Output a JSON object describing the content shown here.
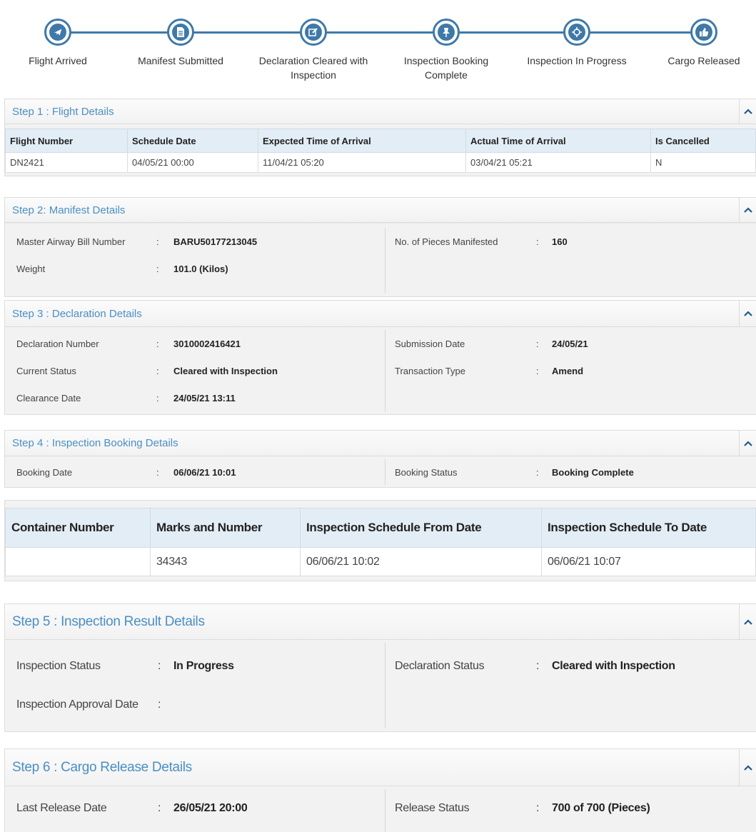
{
  "tracker": {
    "accent": "#3f79a8",
    "steps": [
      {
        "label_line1": "Flight Arrived",
        "label_line2": "",
        "icon": "plane-icon"
      },
      {
        "label_line1": "Manifest Submitted",
        "label_line2": "",
        "icon": "document-icon"
      },
      {
        "label_line1": "Declaration Cleared with",
        "label_line2": "Inspection",
        "icon": "edit-icon"
      },
      {
        "label_line1": "Inspection Booking",
        "label_line2": "Complete",
        "icon": "pin-icon"
      },
      {
        "label_line1": "Inspection In Progress",
        "label_line2": "",
        "icon": "crosshair-icon"
      },
      {
        "label_line1": "Cargo Released",
        "label_line2": "",
        "icon": "thumbs-up-icon"
      }
    ]
  },
  "step1": {
    "title": "Step 1 : Flight Details",
    "headers": [
      "Flight Number",
      "Schedule Date",
      "Expected Time of Arrival",
      "Actual Time of Arrival",
      "Is Cancelled"
    ],
    "row": [
      "DN2421",
      "04/05/21 00:00",
      "11/04/21 05:20",
      "03/04/21 05:21",
      "N"
    ]
  },
  "step2": {
    "title": "Step 2: Manifest Details",
    "mawb_label": "Master Airway Bill Number",
    "mawb_value": "BARU50177213045",
    "weight_label": "Weight",
    "weight_value": "101.0 (Kilos)",
    "pieces_label": "No. of Pieces Manifested",
    "pieces_value": "160"
  },
  "step3": {
    "title": "Step 3 : Declaration Details",
    "decl_no_label": "Declaration Number",
    "decl_no_value": "3010002416421",
    "status_label": "Current Status",
    "status_value": "Cleared with Inspection",
    "clearance_label": "Clearance Date",
    "clearance_value": "24/05/21 13:11",
    "submission_label": "Submission Date",
    "submission_value": "24/05/21",
    "txn_label": "Transaction Type",
    "txn_value": "Amend"
  },
  "step4": {
    "title": "Step 4 : Inspection Booking Details",
    "booking_date_label": "Booking Date",
    "booking_date_value": "06/06/21 10:01",
    "booking_status_label": "Booking Status",
    "booking_status_value": "Booking Complete",
    "container_headers": [
      "Container Number",
      "Marks and Number",
      "Inspection Schedule From Date",
      "Inspection Schedule To Date"
    ],
    "container_row": [
      "",
      "34343",
      "06/06/21 10:02",
      "06/06/21 10:07"
    ]
  },
  "step5": {
    "title": "Step 5 : Inspection Result Details",
    "insp_status_label": "Inspection Status",
    "insp_status_value": "In Progress",
    "approval_label": "Inspection Approval Date",
    "approval_value": "",
    "decl_status_label": "Declaration Status",
    "decl_status_value": "Cleared with Inspection"
  },
  "step6": {
    "title": "Step 6 : Cargo Release Details",
    "last_release_label": "Last Release Date",
    "last_release_value": "26/05/21 20:00",
    "release_status_label": "Release Status",
    "release_status_value": "700 of 700 (Pieces)"
  },
  "colon": ":"
}
